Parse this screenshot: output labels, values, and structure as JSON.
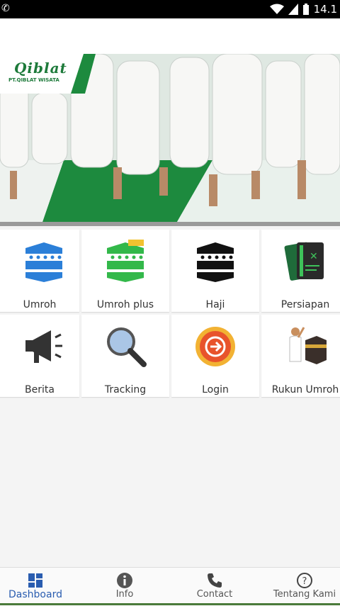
{
  "status_bar": {
    "time": "14.1",
    "left_icon": "whatsapp-icon",
    "icons": [
      "wifi-icon",
      "signal-icon",
      "battery-icon"
    ]
  },
  "banner": {
    "brand_name": "Qiblat",
    "brand_sub": "PT.QIBLAT WISATA",
    "accent_color": "#1d8a3e"
  },
  "menu": {
    "items": [
      {
        "label": "Umroh",
        "icon": "kaaba-blue-icon"
      },
      {
        "label": "Umroh plus",
        "icon": "kaaba-green-icon"
      },
      {
        "label": "Haji",
        "icon": "kaaba-black-icon"
      },
      {
        "label": "Persiapan",
        "icon": "document-icon"
      },
      {
        "label": "Berita",
        "icon": "megaphone-icon"
      },
      {
        "label": "Tracking",
        "icon": "magnifier-icon"
      },
      {
        "label": "Login",
        "icon": "login-arrow-icon"
      },
      {
        "label": "Rukun Umroh",
        "icon": "pilgrim-kaaba-icon"
      }
    ]
  },
  "bottom_nav": {
    "items": [
      {
        "label": "Dashboard",
        "icon": "dashboard-icon",
        "active": true
      },
      {
        "label": "Info",
        "icon": "info-icon"
      },
      {
        "label": "Contact",
        "icon": "phone-icon"
      },
      {
        "label": "Tentang Kami",
        "icon": "help-icon"
      }
    ],
    "active_color": "#2a5db0"
  }
}
